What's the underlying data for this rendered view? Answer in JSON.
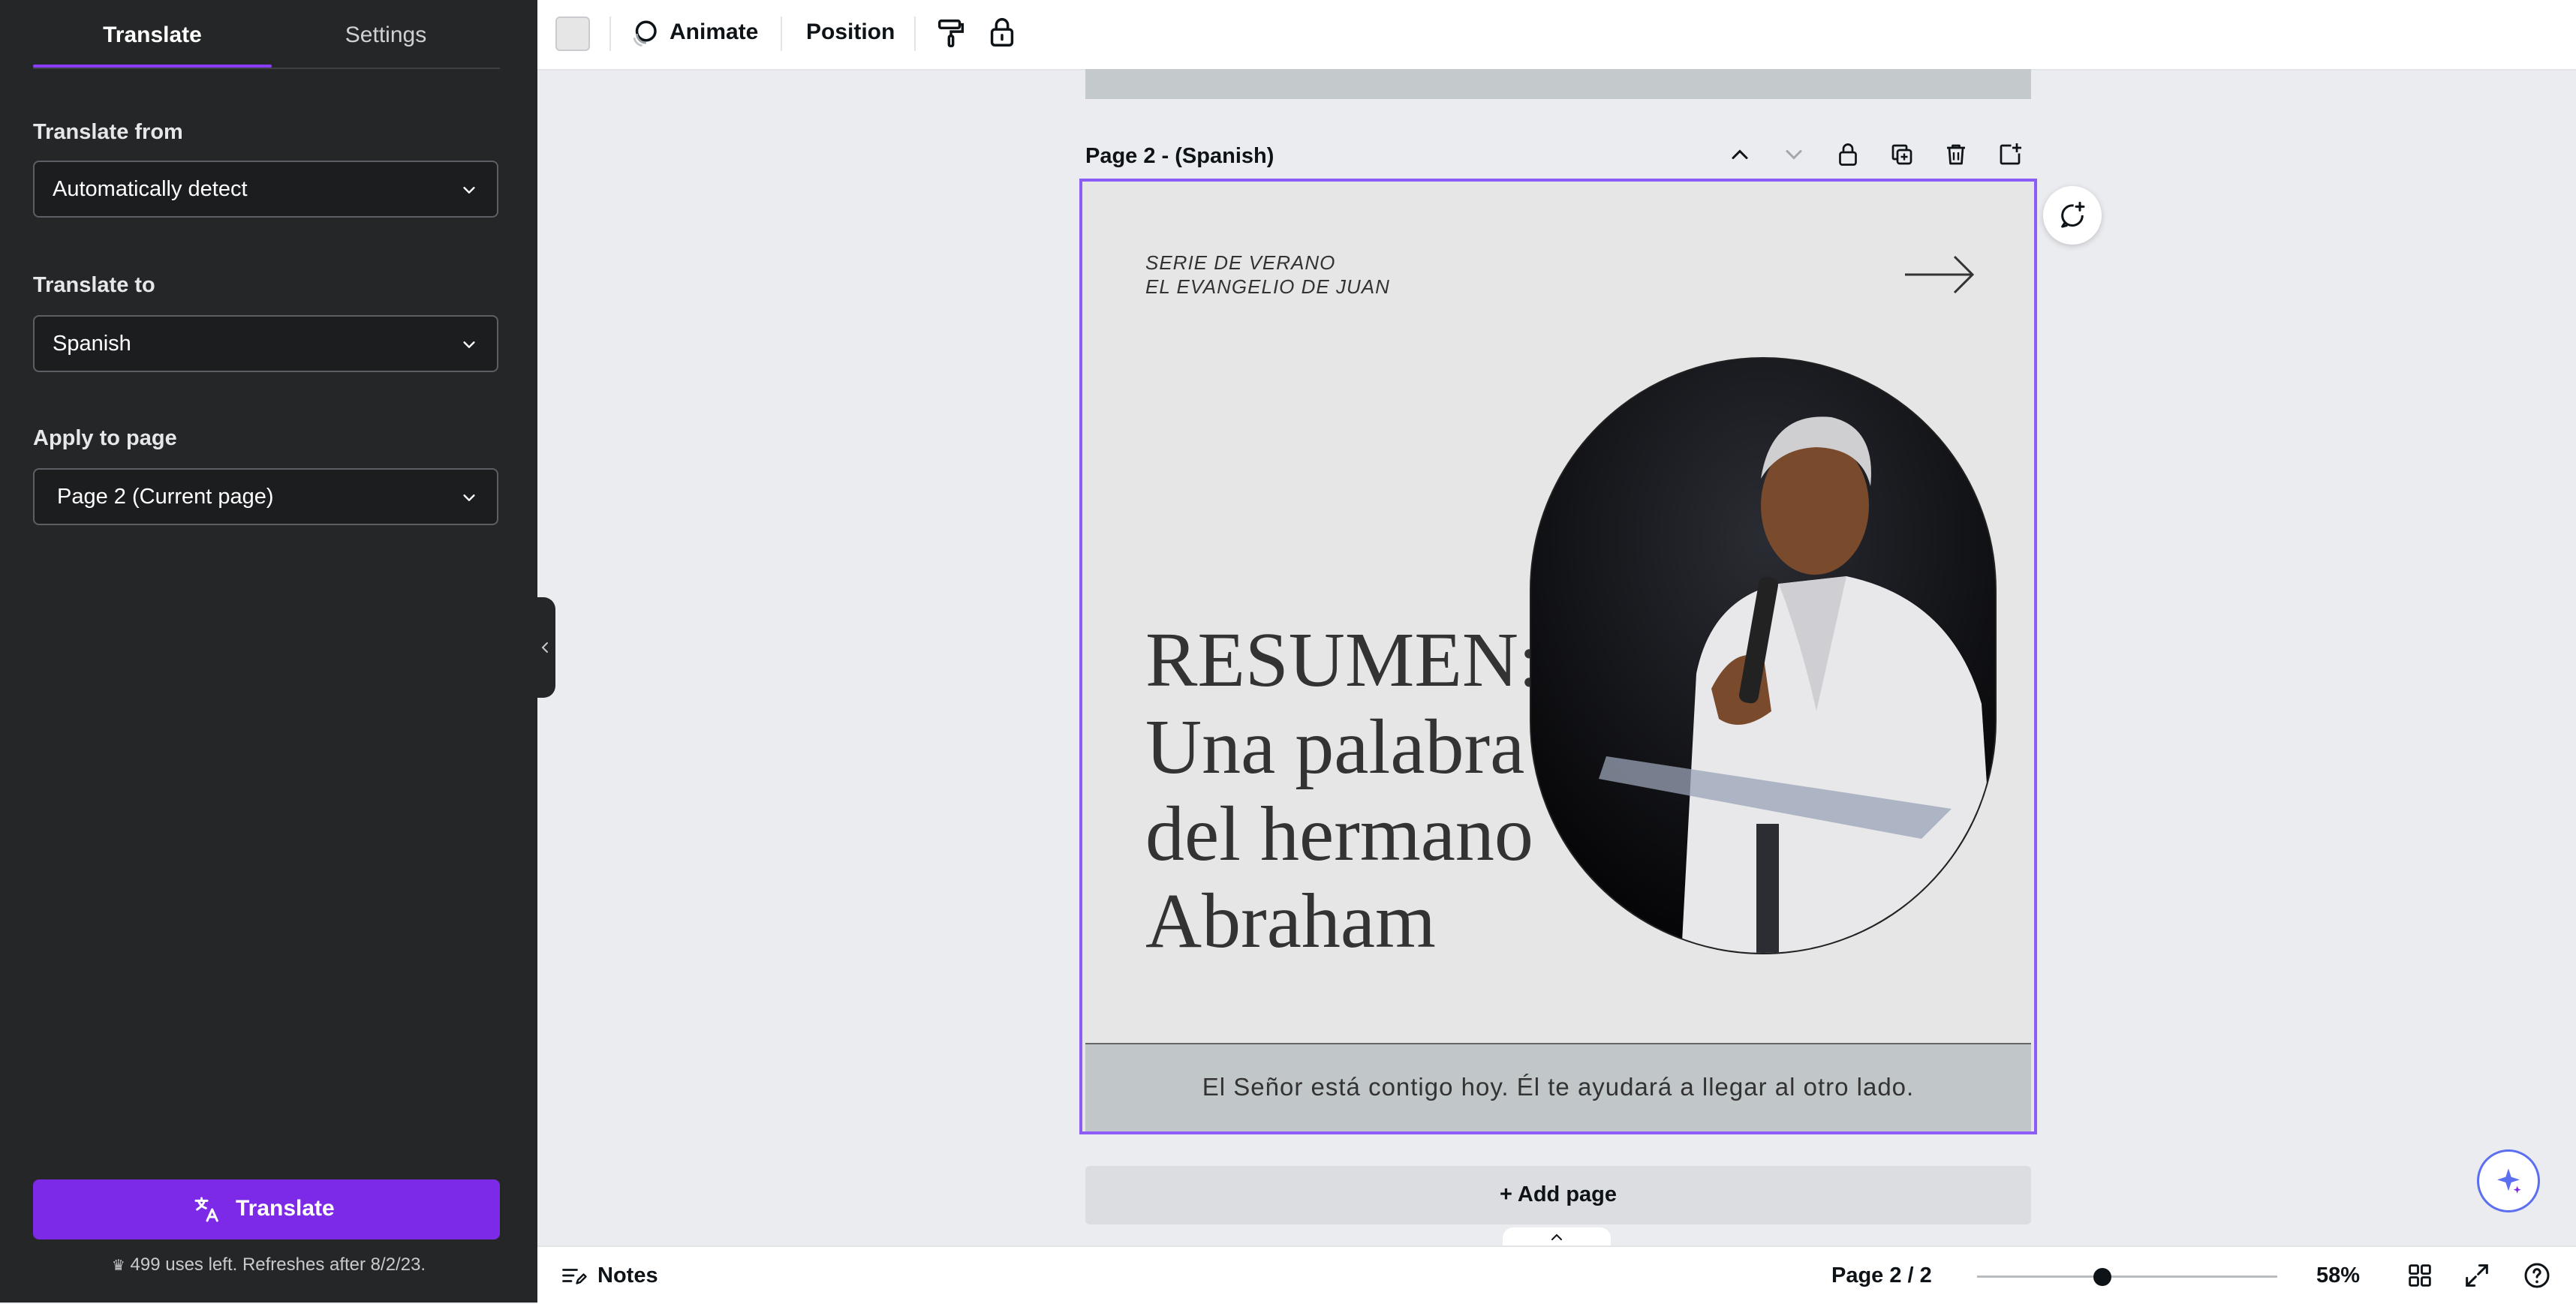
{
  "sidebar": {
    "tabs": [
      {
        "label": "Translate"
      },
      {
        "label": "Settings"
      }
    ],
    "translate_from": {
      "label": "Translate from",
      "value": "Automatically detect"
    },
    "translate_to": {
      "label": "Translate to",
      "value": "Spanish"
    },
    "apply_to_page": {
      "label": "Apply to page",
      "value": "Page 2 (Current page)"
    },
    "translate_button": "Translate",
    "uses_text": "499 uses left. Refreshes after 8/2/23."
  },
  "toolbar": {
    "animate": "Animate",
    "position": "Position"
  },
  "canvas": {
    "page_title": "Page 2 - (Spanish)",
    "series_line1": "SERIE DE VERANO",
    "series_line2": "EL EVANGELIO DE JUAN",
    "headline": [
      "RESUMEN:",
      "Una palabra",
      "del hermano",
      "Abraham"
    ],
    "caption": "El Señor está contigo hoy. Él te ayudará a llegar al otro lado.",
    "add_page": "+ Add page"
  },
  "bottom_bar": {
    "notes": "Notes",
    "page_count": "Page 2 / 2",
    "zoom_percent": 58,
    "zoom_label": "58%"
  },
  "colors": {
    "accent": "#8b3dff",
    "sidebar_bg": "#252627",
    "page_selection": "#8b5cf6"
  }
}
